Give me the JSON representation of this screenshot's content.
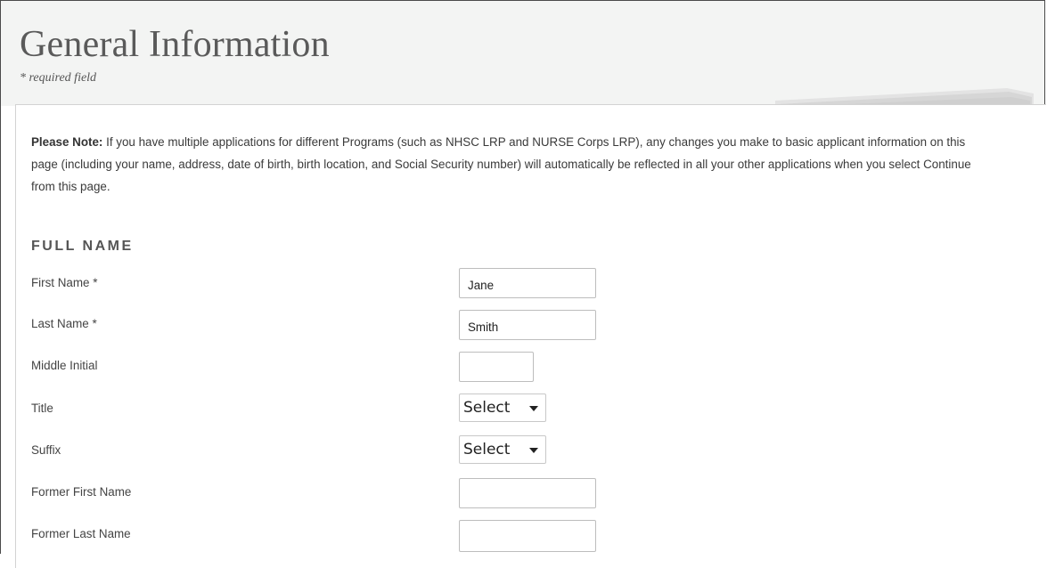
{
  "page": {
    "title": "General Information",
    "required_note": "* required field"
  },
  "note": {
    "lead": "Please Note:",
    "text": " If you have multiple applications for different Programs (such as NHSC LRP and NURSE Corps LRP), any changes you make to basic applicant information on this page (including your name, address, date of birth, birth location, and Social Security number) will automatically be reflected in all your other applications when you select Continue from this page."
  },
  "full_name": {
    "heading": "FULL NAME",
    "first_name": {
      "label": "First Name *",
      "value": "Jane"
    },
    "last_name": {
      "label": "Last Name *",
      "value": "Smith"
    },
    "middle_initial": {
      "label": "Middle Initial",
      "value": ""
    },
    "title": {
      "label": "Title",
      "selected": "Select"
    },
    "suffix": {
      "label": "Suffix",
      "selected": "Select"
    },
    "former_first_name": {
      "label": "Former First Name",
      "value": ""
    },
    "former_last_name": {
      "label": "Former Last Name",
      "value": ""
    }
  },
  "icons": {
    "dropdown": "chevron-down-icon",
    "paper_stack": "paper-stack-decoration"
  },
  "colors": {
    "header_band": "#f3f4f3",
    "title_text": "#5a5a5a",
    "border": "#bdbdbd"
  }
}
